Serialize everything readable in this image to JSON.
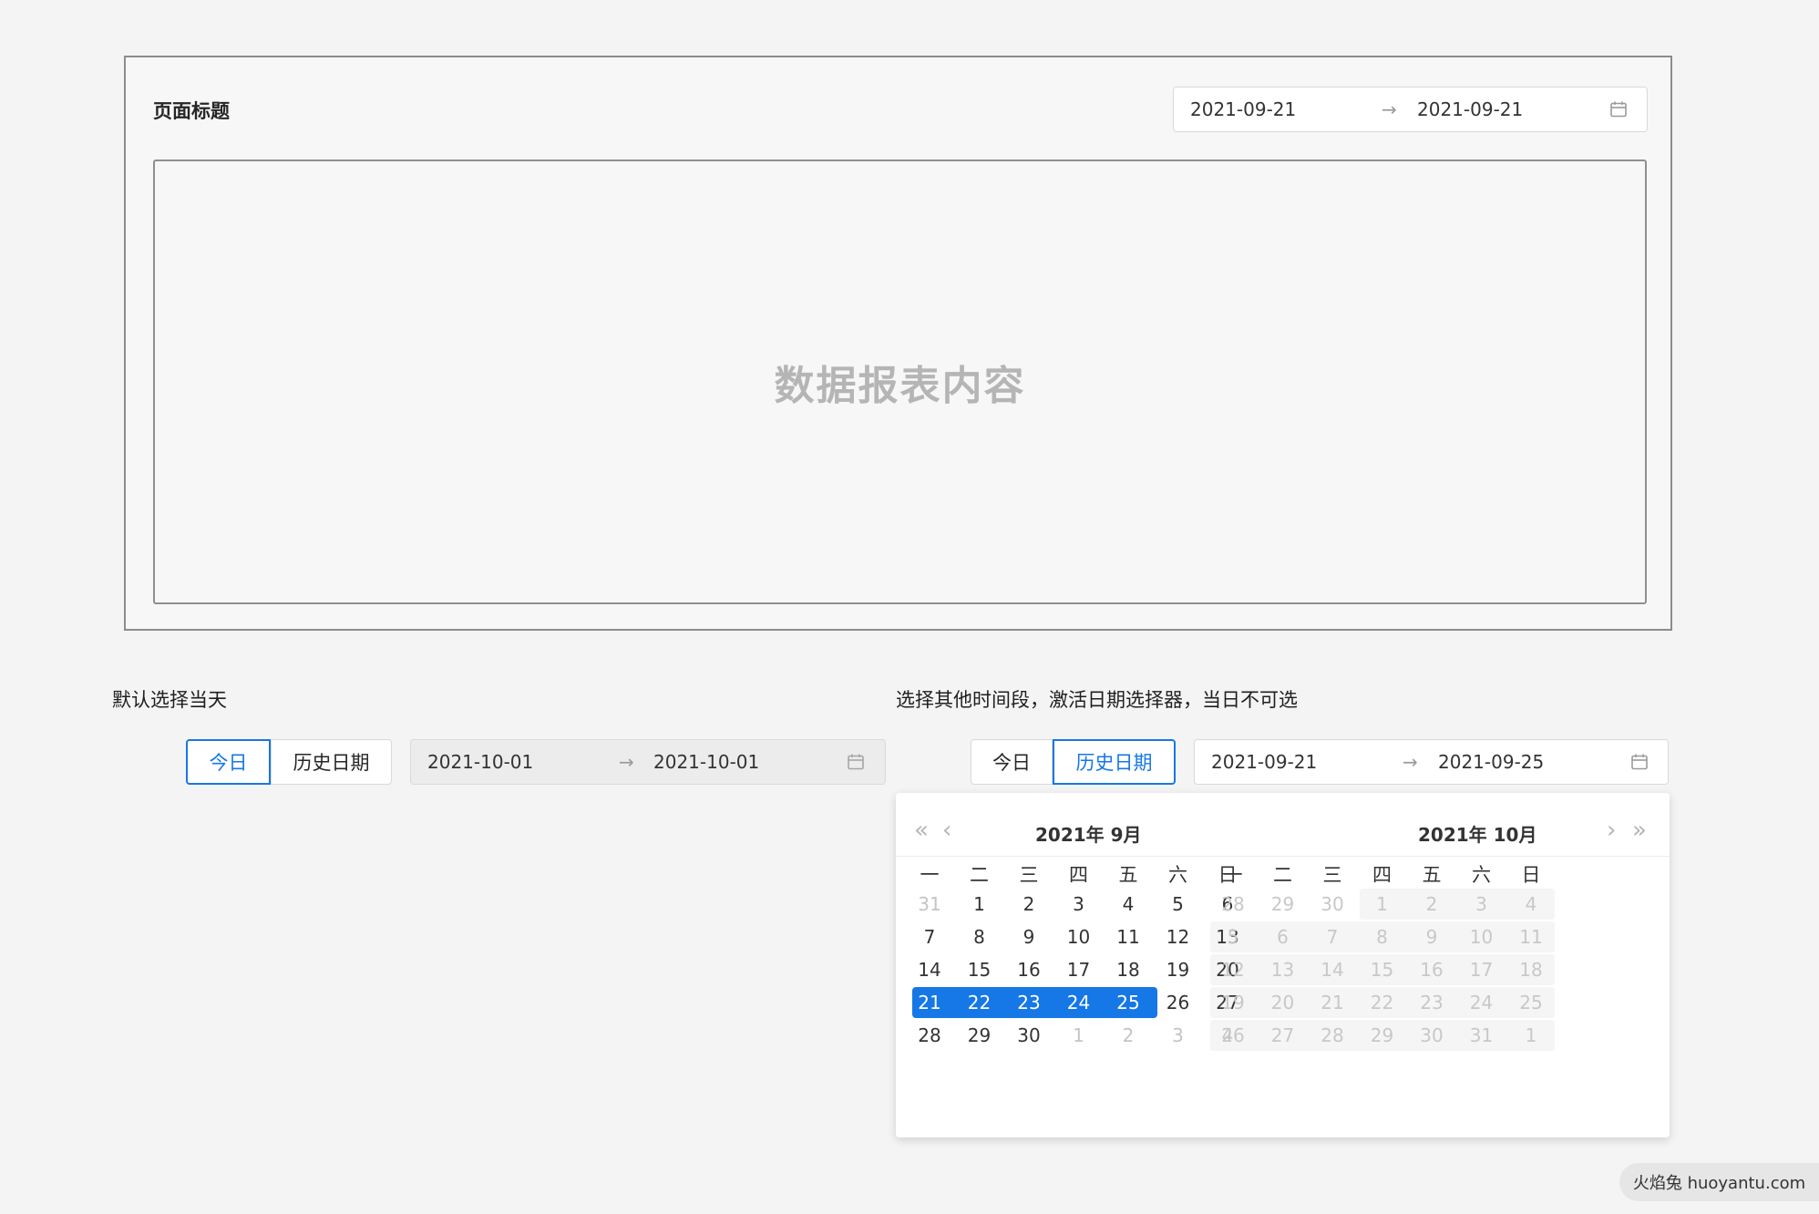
{
  "card": {
    "title": "页面标题",
    "range_start": "2021-09-21",
    "range_end": "2021-09-21",
    "content_label": "数据报表内容"
  },
  "left_demo": {
    "label": "默认选择当天",
    "today": "今日",
    "history": "历史日期",
    "range_start": "2021-10-01",
    "range_end": "2021-10-01"
  },
  "right_demo": {
    "label": "选择其他时间段，激活日期选择器，当日不可选",
    "today": "今日",
    "history": "历史日期",
    "range_start": "2021-09-21",
    "range_end": "2021-09-25"
  },
  "range_arrow": "→",
  "calendar": {
    "left_title": "2021年  9月",
    "right_title": "2021年  10月",
    "weekdays": [
      "一",
      "二",
      "三",
      "四",
      "五",
      "六",
      "日"
    ],
    "left_days": [
      [
        "31",
        "1",
        "2",
        "3",
        "4",
        "5",
        "6"
      ],
      [
        "7",
        "8",
        "9",
        "10",
        "11",
        "12",
        "13"
      ],
      [
        "14",
        "15",
        "16",
        "17",
        "18",
        "19",
        "20"
      ],
      [
        "21",
        "22",
        "23",
        "24",
        "25",
        "26",
        "27"
      ],
      [
        "28",
        "29",
        "30",
        "1",
        "2",
        "3",
        "4"
      ]
    ],
    "right_days": [
      [
        "28",
        "29",
        "30",
        "1",
        "2",
        "3",
        "4"
      ],
      [
        "5",
        "6",
        "7",
        "8",
        "9",
        "10",
        "11"
      ],
      [
        "12",
        "13",
        "14",
        "15",
        "16",
        "17",
        "18"
      ],
      [
        "19",
        "20",
        "21",
        "22",
        "23",
        "24",
        "25"
      ],
      [
        "26",
        "27",
        "28",
        "29",
        "30",
        "31",
        "1"
      ]
    ],
    "selected": [
      "21",
      "22",
      "23",
      "24",
      "25"
    ],
    "nav_prev_year": "«",
    "nav_prev_month": "‹",
    "nav_next_month": "›",
    "nav_next_year": "»"
  },
  "watermark": "火焰兔 huoyantu.com",
  "colors": {
    "accent": "#1677e6",
    "disabled_text": "#c4c4c4"
  }
}
